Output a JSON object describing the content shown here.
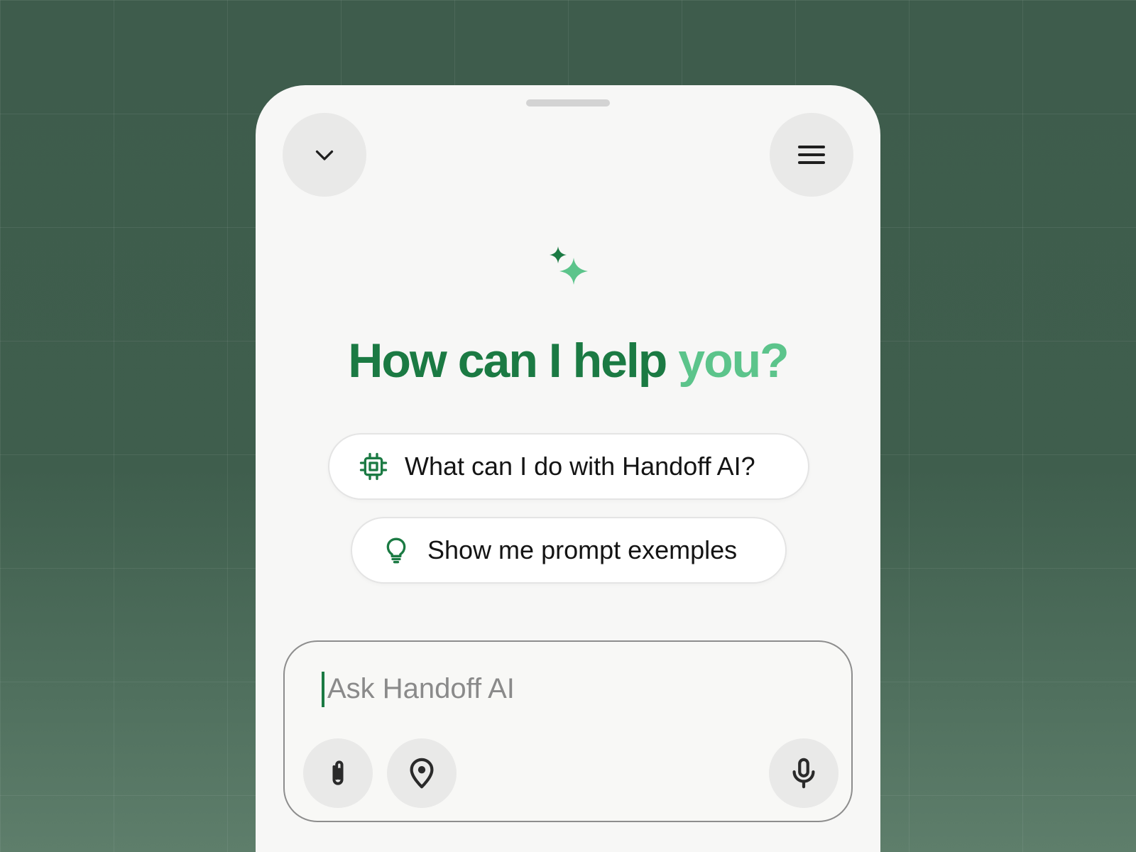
{
  "header": {
    "collapse_icon": "chevron-down-icon",
    "menu_icon": "hamburger-menu-icon"
  },
  "hero": {
    "icon": "sparkle-icon",
    "title_part1": "How can I help",
    "title_part2": "you?"
  },
  "suggestions": [
    {
      "icon": "chip-processor-icon",
      "label": "What can I do with Handoff AI?"
    },
    {
      "icon": "lightbulb-icon",
      "label": "Show me prompt exemples"
    }
  ],
  "composer": {
    "placeholder": "Ask Handoff AI",
    "value": "",
    "tools": [
      "paperclip-icon",
      "location-pin-icon"
    ],
    "mic_icon": "microphone-icon"
  },
  "colors": {
    "primary_green": "#1b7a43",
    "light_green": "#5cc48b",
    "background": "#3e5c4c",
    "surface": "#f7f7f6"
  }
}
